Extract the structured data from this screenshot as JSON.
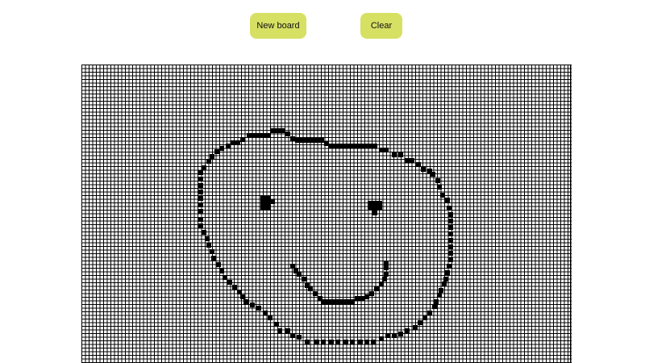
{
  "toolbar": {
    "new_board_label": "New board",
    "clear_label": "Clear"
  },
  "colors": {
    "button_bg": "#d6e063",
    "grid_line": "#000000",
    "cell_fill": "#000000",
    "background": "#ffffff"
  },
  "board": {
    "drawing": "smiley-face"
  }
}
